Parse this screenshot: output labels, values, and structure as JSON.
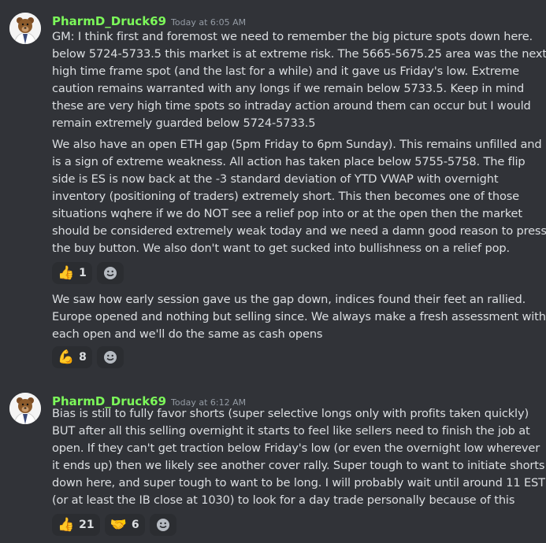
{
  "messages": [
    {
      "username": "PharmD_Druck69",
      "timestamp": "Today at 6:05 AM",
      "paragraphs": [
        [
          "GM: I think first and foremost we need to remember the big picture spots down here.",
          "below 5724-5733.5 this market is at extreme risk. The 5665-5675.25 area was the next",
          "high time frame spot (and the last for a while) and it gave us Friday's low. Extreme",
          "caution remains warranted with any longs if we remain below 5733.5. Keep in mind",
          "these are very high time spots so intraday action around them can occur but I would",
          "remain extremely guarded below 5724-5733.5"
        ],
        [
          "We also have an open ETH gap (5pm Friday to 6pm Sunday). This remains unfilled and",
          "is a sign of extreme weakness. All action has taken place below 5755-5758. The flip",
          "side is ES is now back at the -3 standard deviation of YTD VWAP with overnight",
          "inventory (positioning of traders) extremely short. This then becomes one of those",
          "situations wqhere if we do NOT see a relief pop into or at the open then the market",
          "should be considered extremely weak today and we need a damn good reason to press",
          "the buy button. We also don't want to get sucked into bullishness on a relief pop."
        ]
      ],
      "reactions": [
        {
          "emoji": "👍",
          "icon": "thumbs-up-icon",
          "count": "1"
        }
      ],
      "followup": [
        "We saw how early session gave us the gap down, indices found their feet an rallied.",
        "Europe opened and nothing but selling since. We always make a fresh assessment with",
        "each open and we'll do the same as cash opens"
      ],
      "followup_reactions": [
        {
          "emoji": "💪",
          "icon": "flexed-biceps-icon",
          "count": "8"
        }
      ]
    },
    {
      "username": "PharmD_Druck69",
      "timestamp": "Today at 6:12 AM",
      "paragraphs": [
        [
          "Bias is still to fully favor shorts (super selective longs only with profits taken quickly)",
          "BUT after all this selling overnight it starts to feel like sellers need to finish the job at",
          "open. If they can't get traction below Friday's low (or even the overnight low wherever",
          "it ends up) then we likely see another cover rally. Super tough to want to initiate shorts",
          "down here, and super tough to want to be long. I will probably wait until around 11 EST",
          "(or at least the IB close at 1030) to look for a day trade personally because of this"
        ]
      ],
      "reactions": [
        {
          "emoji": "👍",
          "icon": "thumbs-up-icon",
          "count": "21"
        },
        {
          "emoji": "🤝",
          "icon": "handshake-icon",
          "count": "6"
        }
      ]
    }
  ],
  "colors": {
    "background": "#313338",
    "username": "#7cf85a",
    "text": "#dbdee1",
    "reaction_bg": "#2b2d31"
  }
}
